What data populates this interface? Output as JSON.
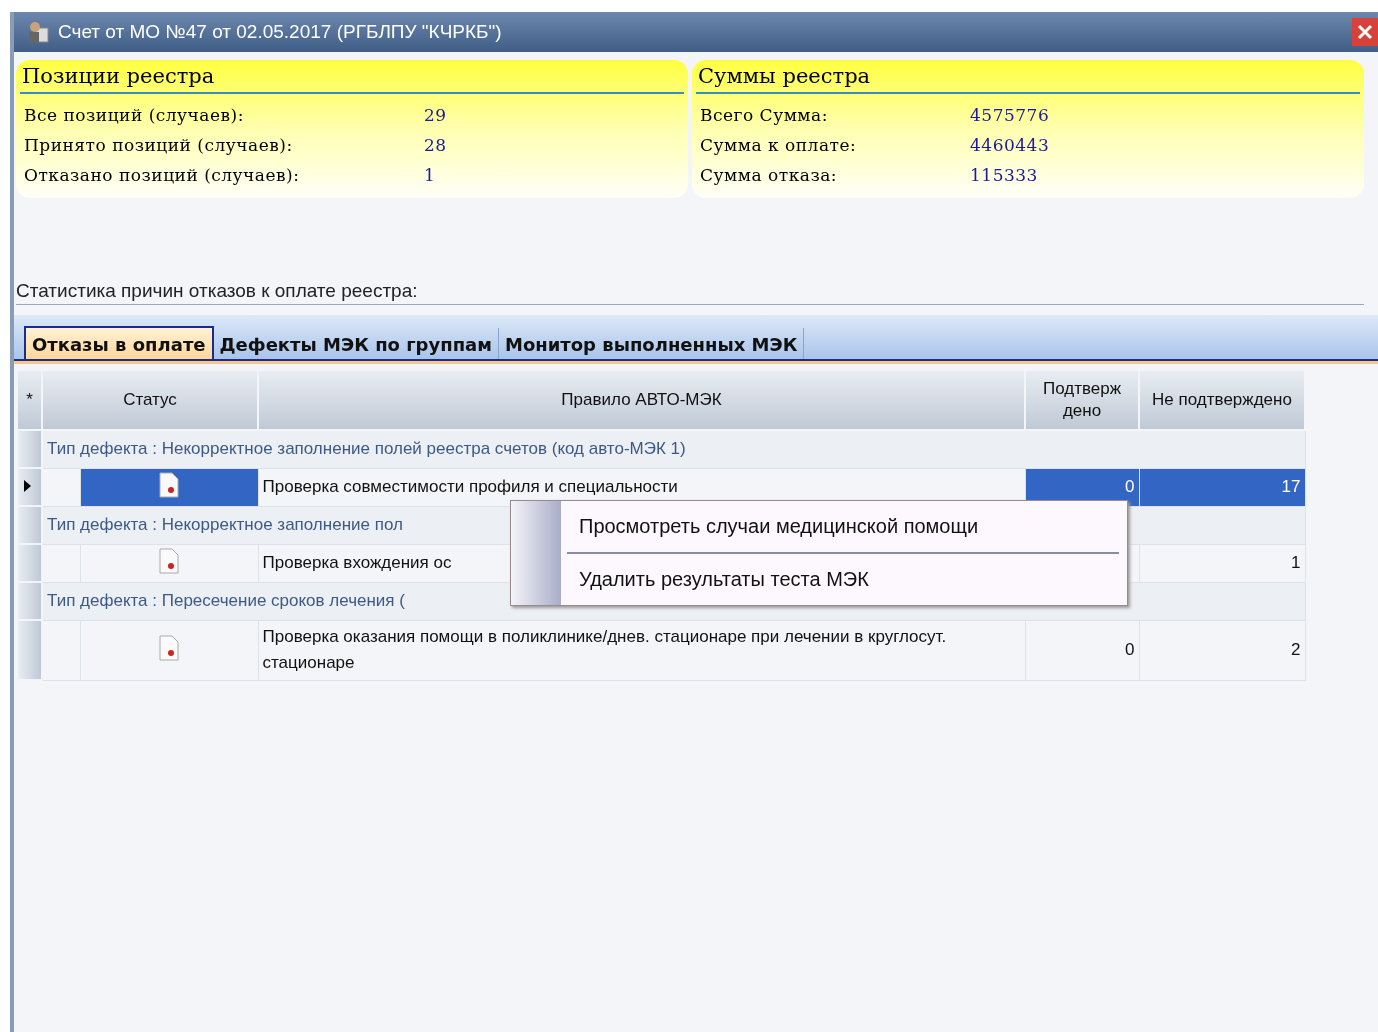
{
  "window": {
    "title": "Счет от МО №47 от 02.05.2017 (РГБЛПУ \"КЧРКБ\")"
  },
  "panels": [
    {
      "title": "Позиции реестра",
      "rows": [
        {
          "label": "Все позиций (случаев):",
          "value": "29"
        },
        {
          "label": "Принято позиций (случаев):",
          "value": "28"
        },
        {
          "label": "Отказано позиций (случаев):",
          "value": "1"
        }
      ]
    },
    {
      "title": "Суммы реестра",
      "rows": [
        {
          "label": "Всего Сумма:",
          "value": "4575776"
        },
        {
          "label": "Сумма к оплате:",
          "value": "4460443"
        },
        {
          "label": "Сумма отказа:",
          "value": "115333"
        }
      ]
    }
  ],
  "stats_label": "Статистика причин отказов к оплате реестра:",
  "tabs": [
    {
      "label": "Отказы в оплате",
      "selected": true
    },
    {
      "label": "Дефекты МЭК по группам",
      "selected": false
    },
    {
      "label": "Монитор выполненных МЭК",
      "selected": false
    }
  ],
  "table": {
    "columns": [
      "*",
      "Статус",
      "Правило АВТО-МЭК",
      "Подтверж дено",
      "Не подтверждено"
    ],
    "groups": [
      {
        "title": "Тип дефекта : Некорректное заполнение полей реестра счетов (код авто-МЭК 1)",
        "rows": [
          {
            "rule": "Проверка совместимости профиля и специальности",
            "confirmed": "0",
            "unconfirmed": "17",
            "selected": true
          }
        ]
      },
      {
        "title": "Тип дефекта : Некорректное заполнение пол",
        "rows": [
          {
            "rule": "Проверка вхождения ос",
            "unconfirmed": "1",
            "selected": false
          }
        ]
      },
      {
        "title": "Тип дефекта : Пересечение сроков лечения (",
        "rows": [
          {
            "rule": "Проверка оказания помощи в поликлинике/днев. стационаре при лечении в круглосут. стационаре",
            "confirmed": "0",
            "unconfirmed": "2",
            "selected": false
          }
        ]
      }
    ]
  },
  "context_menu": {
    "items": [
      "Просмотреть случаи медицинской помощи",
      "Удалить результаты теста МЭК"
    ]
  }
}
